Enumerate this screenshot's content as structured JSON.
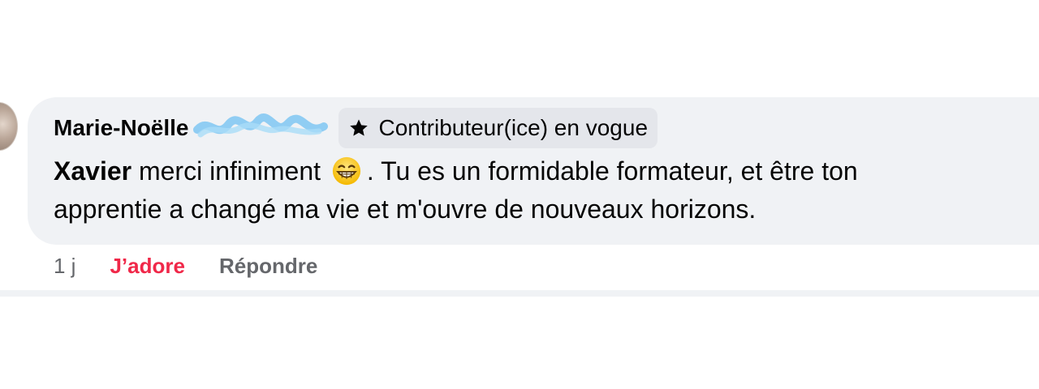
{
  "comment": {
    "author": "Marie-Noëlle",
    "badge": {
      "icon": "star-icon",
      "label": "Contributeur(ice) en vogue"
    },
    "mention": "Xavier",
    "text_part1": " merci infiniment",
    "emoji": "grinning-face-with-smiling-eyes",
    "text_part2": ". Tu es un formidable formateur, et être ton",
    "text_line2": "apprentie a changé ma vie et m'ouvre de nouveaux horizons."
  },
  "actions": {
    "time": "1 j",
    "like_label": "J’adore",
    "reply_label": "Répondre"
  },
  "colors": {
    "bubble_bg": "#f0f2f5",
    "badge_bg": "#e4e6eb",
    "like_red": "#f02849",
    "secondary_text": "#65676b",
    "redaction_blue": "#7fc7f2"
  }
}
